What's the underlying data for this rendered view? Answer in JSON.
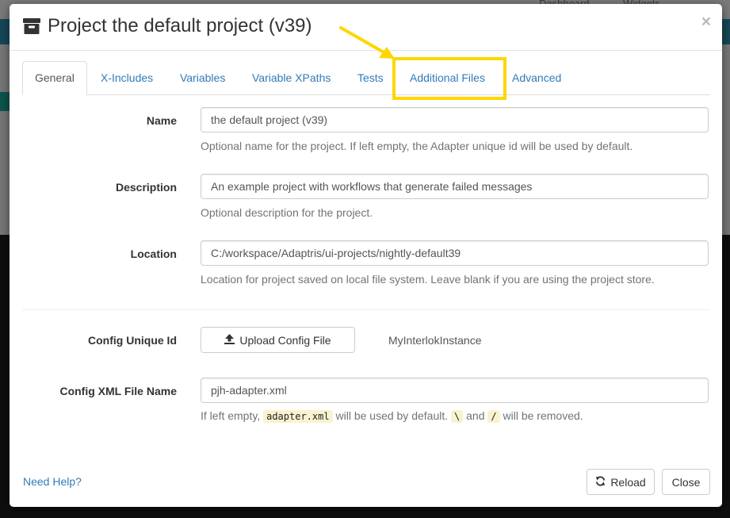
{
  "background": {
    "topbar_left": "Dashboard",
    "topbar_right": "Widgets"
  },
  "modal": {
    "title": "Project the default project (v39)",
    "close_label": "×",
    "tabs": [
      {
        "label": "General",
        "active": true
      },
      {
        "label": "X-Includes",
        "active": false
      },
      {
        "label": "Variables",
        "active": false
      },
      {
        "label": "Variable XPaths",
        "active": false
      },
      {
        "label": "Tests",
        "active": false
      },
      {
        "label": "Additional Files",
        "active": false,
        "highlighted": true
      },
      {
        "label": "Advanced",
        "active": false
      }
    ],
    "fields": {
      "name": {
        "label": "Name",
        "value": "the default project (v39)",
        "help": "Optional name for the project. If left empty, the Adapter unique id will be used by default."
      },
      "description": {
        "label": "Description",
        "value": "An example project with workflows that generate failed messages",
        "help": "Optional description for the project."
      },
      "location": {
        "label": "Location",
        "value": "C:/workspace/Adaptris/ui-projects/nightly-default39",
        "help": "Location for project saved on local file system. Leave blank if you are using the project store."
      },
      "config_unique_id": {
        "label": "Config Unique Id",
        "upload_button": "Upload Config File",
        "value": "MyInterlokInstance"
      },
      "config_xml_file_name": {
        "label": "Config XML File Name",
        "value": "pjh-adapter.xml",
        "help_prefix": "If left empty,",
        "help_code1": "adapter.xml",
        "help_mid": "will be used by default.",
        "help_code2": "\\",
        "help_and": "and",
        "help_code3": "/",
        "help_suffix": "will be removed."
      }
    },
    "footer": {
      "help_link": "Need Help?",
      "reload_button": "Reload",
      "close_button": "Close"
    }
  },
  "colors": {
    "link": "#337ab7",
    "highlight": "#ffd600",
    "code_bg": "#f9f2d0"
  }
}
